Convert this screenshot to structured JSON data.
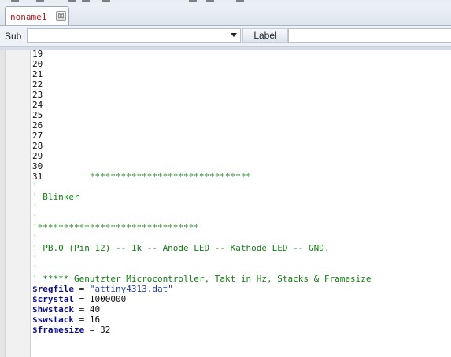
{
  "tab": {
    "label": "noname1",
    "close_glyph": "⊠"
  },
  "subbar": {
    "sub_label": "Sub",
    "sub_value": "",
    "label_button": "Label",
    "label_value": ""
  },
  "editor": {
    "lines": [
      [
        {
          "t": "19",
          "c": "plain"
        }
      ],
      [
        {
          "t": "20",
          "c": "plain"
        }
      ],
      [
        {
          "t": "21",
          "c": "plain"
        }
      ],
      [
        {
          "t": "22",
          "c": "plain"
        }
      ],
      [
        {
          "t": "23",
          "c": "plain"
        }
      ],
      [
        {
          "t": "24",
          "c": "plain"
        }
      ],
      [
        {
          "t": "25",
          "c": "plain"
        }
      ],
      [
        {
          "t": "26",
          "c": "plain"
        }
      ],
      [
        {
          "t": "27",
          "c": "plain"
        }
      ],
      [
        {
          "t": "28",
          "c": "plain"
        }
      ],
      [
        {
          "t": "29",
          "c": "plain"
        }
      ],
      [
        {
          "t": "30",
          "c": "plain"
        }
      ],
      [
        {
          "t": "31",
          "c": "plain"
        },
        {
          "t": "        '*******************************",
          "c": "green"
        }
      ],
      [
        {
          "t": "'",
          "c": "green"
        }
      ],
      [
        {
          "t": "' Blinker",
          "c": "green"
        }
      ],
      [
        {
          "t": "'",
          "c": "green"
        }
      ],
      [
        {
          "t": "'",
          "c": "green"
        }
      ],
      [
        {
          "t": "'*******************************",
          "c": "green"
        }
      ],
      [
        {
          "t": "'",
          "c": "green"
        }
      ],
      [
        {
          "t": "' PB.0 (Pin 12) -- 1k -- Anode LED -- Kathode LED -- GND.",
          "c": "green"
        }
      ],
      [
        {
          "t": "'",
          "c": "green"
        }
      ],
      [
        {
          "t": "'",
          "c": "green"
        }
      ],
      [
        {
          "t": "' ***** Genutzter Microcontroller, Takt in Hz, Stacks & Framesize",
          "c": "green"
        }
      ],
      [
        {
          "t": "$regfile",
          "c": "var"
        },
        {
          "t": " = ",
          "c": "plain"
        },
        {
          "t": "\"attiny4313.dat\"",
          "c": "str"
        }
      ],
      [
        {
          "t": "$crystal",
          "c": "var"
        },
        {
          "t": " = 1000000",
          "c": "plain"
        }
      ],
      [
        {
          "t": "$hwstack",
          "c": "var"
        },
        {
          "t": " = 40",
          "c": "plain"
        }
      ],
      [
        {
          "t": "$swstack",
          "c": "var"
        },
        {
          "t": " = 16",
          "c": "plain"
        }
      ],
      [
        {
          "t": "$framesize",
          "c": "var"
        },
        {
          "t": " = 32",
          "c": "plain"
        }
      ]
    ]
  },
  "colors": {
    "tab_text": "#c0111a",
    "comment": "#118011",
    "directive": "#0d0d8a",
    "string": "#1d3fb5"
  }
}
